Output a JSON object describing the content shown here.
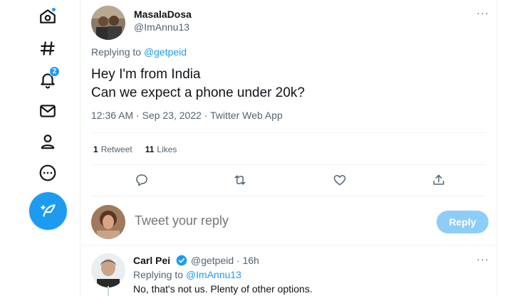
{
  "nav": {
    "notification_count": "2",
    "items": [
      "home-icon",
      "explore-icon",
      "notifications-icon",
      "messages-icon",
      "profile-icon",
      "more-icon"
    ],
    "compose": "compose-tweet-icon"
  },
  "tweet": {
    "author_name": "MasalaDosa",
    "author_handle": "@ImAnnu13",
    "replying_prefix": "Replying to",
    "replying_to": "@getpeid",
    "text_line1": "Hey I'm from India",
    "text_line2": "Can we expect a phone under 20k?",
    "time": "12:36 AM",
    "date": "Sep 23, 2022",
    "source": "Twitter Web App",
    "sep": "·",
    "retweet_count": "1",
    "retweet_label": "Retweet",
    "like_count": "11",
    "like_label": "Likes",
    "more": "···"
  },
  "composer": {
    "placeholder": "Tweet your reply",
    "button_label": "Reply"
  },
  "reply": {
    "author_name": "Carl Pei",
    "author_handle": "@getpeid",
    "sep": "·",
    "age": "16h",
    "replying_prefix": "Replying to",
    "replying_to": "@ImAnnu13",
    "text": "No, that's not us. Plenty of other options.",
    "more": "···"
  },
  "colors": {
    "accent": "#1d9bf0",
    "text": "#0f1419",
    "muted": "#536471",
    "reply_button_disabled": "#8ecdf7"
  }
}
